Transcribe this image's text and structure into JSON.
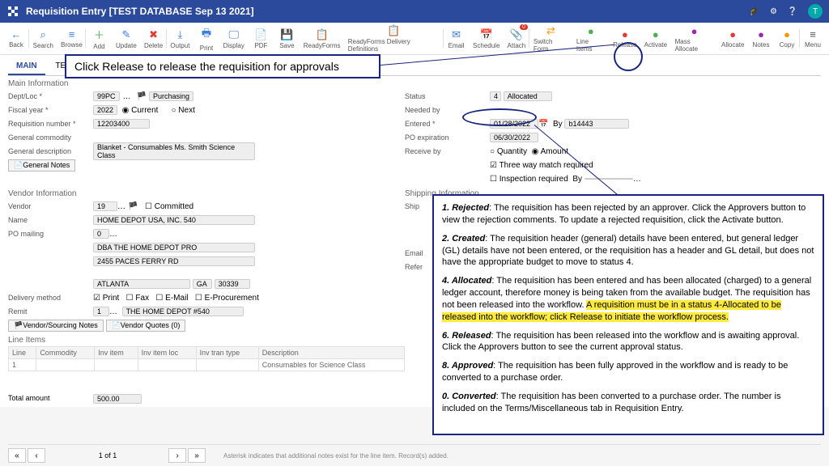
{
  "titlebar": {
    "title": "Requisition Entry [TEST DATABASE Sep 13 2021]",
    "avatar": "T"
  },
  "toolbar": [
    {
      "icon": "←",
      "cls": "ic-blue",
      "label": "Back",
      "sep": true
    },
    {
      "icon": "⌕",
      "cls": "ic-blue",
      "label": "Search"
    },
    {
      "icon": "≡",
      "cls": "ic-blue",
      "label": "Browse",
      "sep": true
    },
    {
      "icon": "＋",
      "cls": "ic-green",
      "label": "Add"
    },
    {
      "icon": "✎",
      "cls": "ic-blue",
      "label": "Update"
    },
    {
      "icon": "✖",
      "cls": "ic-red",
      "label": "Delete",
      "sep": true
    },
    {
      "icon": "⤓",
      "cls": "ic-blue",
      "label": "Output"
    },
    {
      "icon": "🖶",
      "cls": "ic-blue",
      "label": "Print"
    },
    {
      "icon": "🖵",
      "cls": "ic-blue",
      "label": "Display"
    },
    {
      "icon": "📄",
      "cls": "ic-red",
      "label": "PDF"
    },
    {
      "icon": "💾",
      "cls": "ic-blue",
      "label": "Save"
    },
    {
      "icon": "📋",
      "cls": "ic-orange",
      "label": "ReadyForms"
    },
    {
      "icon": "📋",
      "cls": "ic-orange",
      "label": "ReadyForms Delivery Definitions",
      "sep": true
    },
    {
      "icon": "✉",
      "cls": "ic-blue",
      "label": "Email"
    },
    {
      "icon": "📅",
      "cls": "ic-blue",
      "label": "Schedule"
    },
    {
      "icon": "📎",
      "cls": "ic-orange",
      "label": "Attach",
      "badge": "0",
      "sep": true
    },
    {
      "icon": "⇄",
      "cls": "ic-orange",
      "label": "Switch Form"
    },
    {
      "icon": "●",
      "cls": "ic-green",
      "label": "Line Items"
    },
    {
      "icon": "●",
      "cls": "ic-red",
      "label": "Release"
    },
    {
      "icon": "●",
      "cls": "ic-green",
      "label": "Activate"
    },
    {
      "icon": "●",
      "cls": "ic-purple",
      "label": "Mass Allocate"
    },
    {
      "icon": "●",
      "cls": "ic-red",
      "label": "Allocate"
    },
    {
      "icon": "●",
      "cls": "ic-purple",
      "label": "Notes"
    },
    {
      "icon": "●",
      "cls": "ic-orange",
      "label": "Copy",
      "sep": true
    },
    {
      "icon": "≡",
      "cls": "",
      "label": "Menu"
    }
  ],
  "tabs": {
    "main": "MAIN",
    "terms": "TERMS/MISCELLANEOUS"
  },
  "sections": {
    "main_info": "Main Information",
    "vendor_info": "Vendor Information",
    "shipping_info": "Shipping Information",
    "line_items": "Line Items"
  },
  "main": {
    "dept_loc_label": "Dept/Loc *",
    "dept_loc": "99PC",
    "dept_loc_name": "Purchasing",
    "fy_label": "Fiscal year *",
    "fy": "2022",
    "fy_current": "Current",
    "fy_next": "Next",
    "reqnum_label": "Requisition number *",
    "reqnum": "12203400",
    "gen_comm_label": "General commodity",
    "gen_desc_label": "General description",
    "gen_desc": "Blanket - Consumables Ms. Smith Science Class",
    "gen_notes_btn": "General Notes",
    "status_label": "Status",
    "status_code": "4",
    "status_text": "Allocated",
    "needed_label": "Needed by",
    "entered_label": "Entered *",
    "entered": "01/28/2022",
    "by_label": "By",
    "by": "b14443",
    "poexp_label": "PO expiration",
    "poexp": "06/30/2022",
    "recvby_label": "Receive by",
    "recv_qty": "Quantity",
    "recv_amt": "Amount",
    "threeway": "Three way match required",
    "insp_req": "Inspection required",
    "insp_by": "By"
  },
  "vendor": {
    "vendor_label": "Vendor",
    "vendor_code": "19",
    "committed": "Committed",
    "name_label": "Name",
    "name": "HOME DEPOT USA, INC. 540",
    "pomail_label": "PO mailing",
    "pomail": "0",
    "addr1": "DBA THE HOME DEPOT PRO",
    "addr2": "2455 PACES FERRY RD",
    "city": "ATLANTA",
    "state": "GA",
    "zip": "30339",
    "delivery_label": "Delivery method",
    "print": "Print",
    "fax": "Fax",
    "email": "E-Mail",
    "eproc": "E-Procurement",
    "remit_label": "Remit",
    "remit": "1",
    "remit_name": "THE HOME DEPOT #540",
    "vendor_notes_btn": "Vendor/Sourcing Notes",
    "vendor_quotes_btn": "Vendor Quotes (0)",
    "ship_label": "Ship",
    "email_label": "Email",
    "ref_label": "Refer"
  },
  "lineitems": {
    "cols": {
      "line": "Line",
      "commodity": "Commodity",
      "invitem": "Inv item",
      "invloc": "Inv item loc",
      "invtran": "Inv tran type",
      "desc": "Description"
    },
    "row1_line": "1",
    "row1_desc": "Consumables for Science Class",
    "total_label": "Total amount",
    "total": "500.00"
  },
  "pager": {
    "pos": "1 of 1",
    "footnote": "Asterisk indicates that additional notes exist for the line item.  Record(s) added."
  },
  "callout": {
    "release_text": "Click Release to release the requisition for approvals"
  },
  "info": {
    "p1a": "1. Rejected",
    "p1b": ": The requisition has been rejected by an approver. Click the Approvers button to view the rejection comments. To update a rejected requisition, click the Activate button.",
    "p2a": "2. Created",
    "p2b": ": The requisition header (general) details have been entered, but general ledger (GL) details have not been entered, or the requisition has a header and GL detail, but does not have the appropriate budget to move to status 4.",
    "p4a": "4. Allocated",
    "p4b": ": The requisition has been entered and has been allocated (charged) to a general ledger account, therefore money is being taken from the available budget. The requisition has not been released into the workflow. ",
    "p4hl": "A requisition must be in a status 4-Allocated to be released into the workflow; click Release to initiate the workflow process.",
    "p6a": "6. Released",
    "p6b": ": The requisition has been released into the workflow and is awaiting approval. Click the Approvers button to see the current approval status.",
    "p8a": "8. Approved",
    "p8b": ": The requisition has been fully approved in the workflow and is ready to be converted to a purchase order.",
    "p0a": "0. Converted",
    "p0b": ": The requisition has been converted to a purchase order. The number is included on the Terms/Miscellaneous tab in Requisition Entry."
  }
}
